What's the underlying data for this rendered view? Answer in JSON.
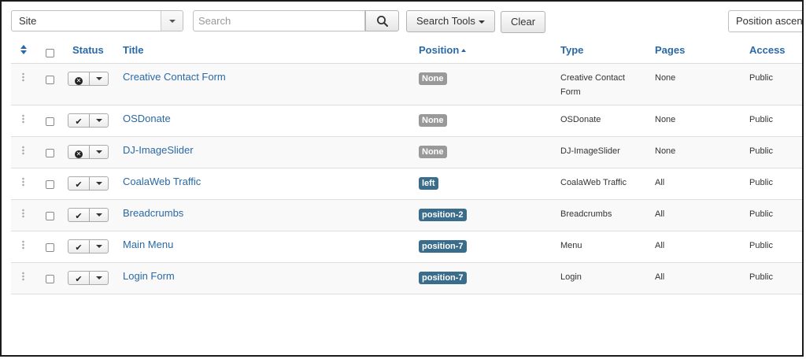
{
  "toolbar": {
    "client_filter": "Site",
    "search_placeholder": "Search",
    "search_tools_label": "Search Tools",
    "clear_label": "Clear",
    "ordering_value": "Position ascending"
  },
  "columns": {
    "status": "Status",
    "title": "Title",
    "position": "Position",
    "type": "Type",
    "pages": "Pages",
    "access": "Access"
  },
  "rows": [
    {
      "title": "Creative Contact Form",
      "published": false,
      "position": "None",
      "position_assigned": false,
      "type": "Creative Contact Form",
      "pages": "None",
      "access": "Public"
    },
    {
      "title": "OSDonate",
      "published": true,
      "position": "None",
      "position_assigned": false,
      "type": "OSDonate",
      "pages": "None",
      "access": "Public"
    },
    {
      "title": "DJ-ImageSlider",
      "published": false,
      "position": "None",
      "position_assigned": false,
      "type": "DJ-ImageSlider",
      "pages": "None",
      "access": "Public"
    },
    {
      "title": "CoalaWeb Traffic",
      "published": true,
      "position": "left",
      "position_assigned": true,
      "type": "CoalaWeb Traffic",
      "pages": "All",
      "access": "Public"
    },
    {
      "title": "Breadcrumbs",
      "published": true,
      "position": "position-2",
      "position_assigned": true,
      "type": "Breadcrumbs",
      "pages": "All",
      "access": "Public"
    },
    {
      "title": "Main Menu",
      "published": true,
      "position": "position-7",
      "position_assigned": true,
      "type": "Menu",
      "pages": "All",
      "access": "Public"
    },
    {
      "title": "Login Form",
      "published": true,
      "position": "position-7",
      "position_assigned": true,
      "type": "Login",
      "pages": "All",
      "access": "Public"
    }
  ],
  "colors": {
    "link": "#2a69a5",
    "badge_none": "#999999",
    "badge_position": "#3a6d8c"
  },
  "icons": {
    "published": "check-icon",
    "unpublished": "circle-x-icon",
    "search": "search-icon",
    "drag": "drag-handle-icon",
    "sort": "sort-icon"
  }
}
